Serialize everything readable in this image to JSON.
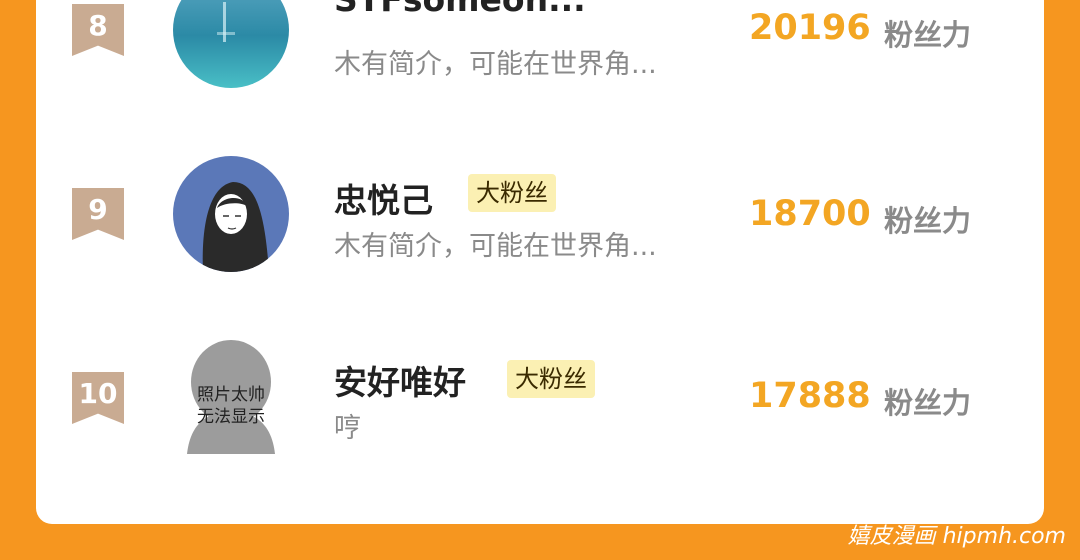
{
  "ranking": {
    "rows": [
      {
        "rank": "8",
        "name": "STFsomeon...",
        "badge": "",
        "bio": "木有简介，可能在世界角...",
        "score": "20196",
        "unit": "粉丝力"
      },
      {
        "rank": "9",
        "name": "忠悦己",
        "badge": "大粉丝",
        "bio": "木有简介，可能在世界角...",
        "score": "18700",
        "unit": "粉丝力"
      },
      {
        "rank": "10",
        "name": "安好唯好",
        "badge": "大粉丝",
        "bio": "哼",
        "score": "17888",
        "unit": "粉丝力",
        "avatar_placeholder": "照片太帅\n无法显示"
      }
    ]
  },
  "watermark": "嬉皮漫画 hipmh.com",
  "colors": {
    "background": "#f6961f",
    "score": "#f3a623",
    "badge_bg": "#fbf0b3",
    "rank_flag": "#c9ab92"
  }
}
